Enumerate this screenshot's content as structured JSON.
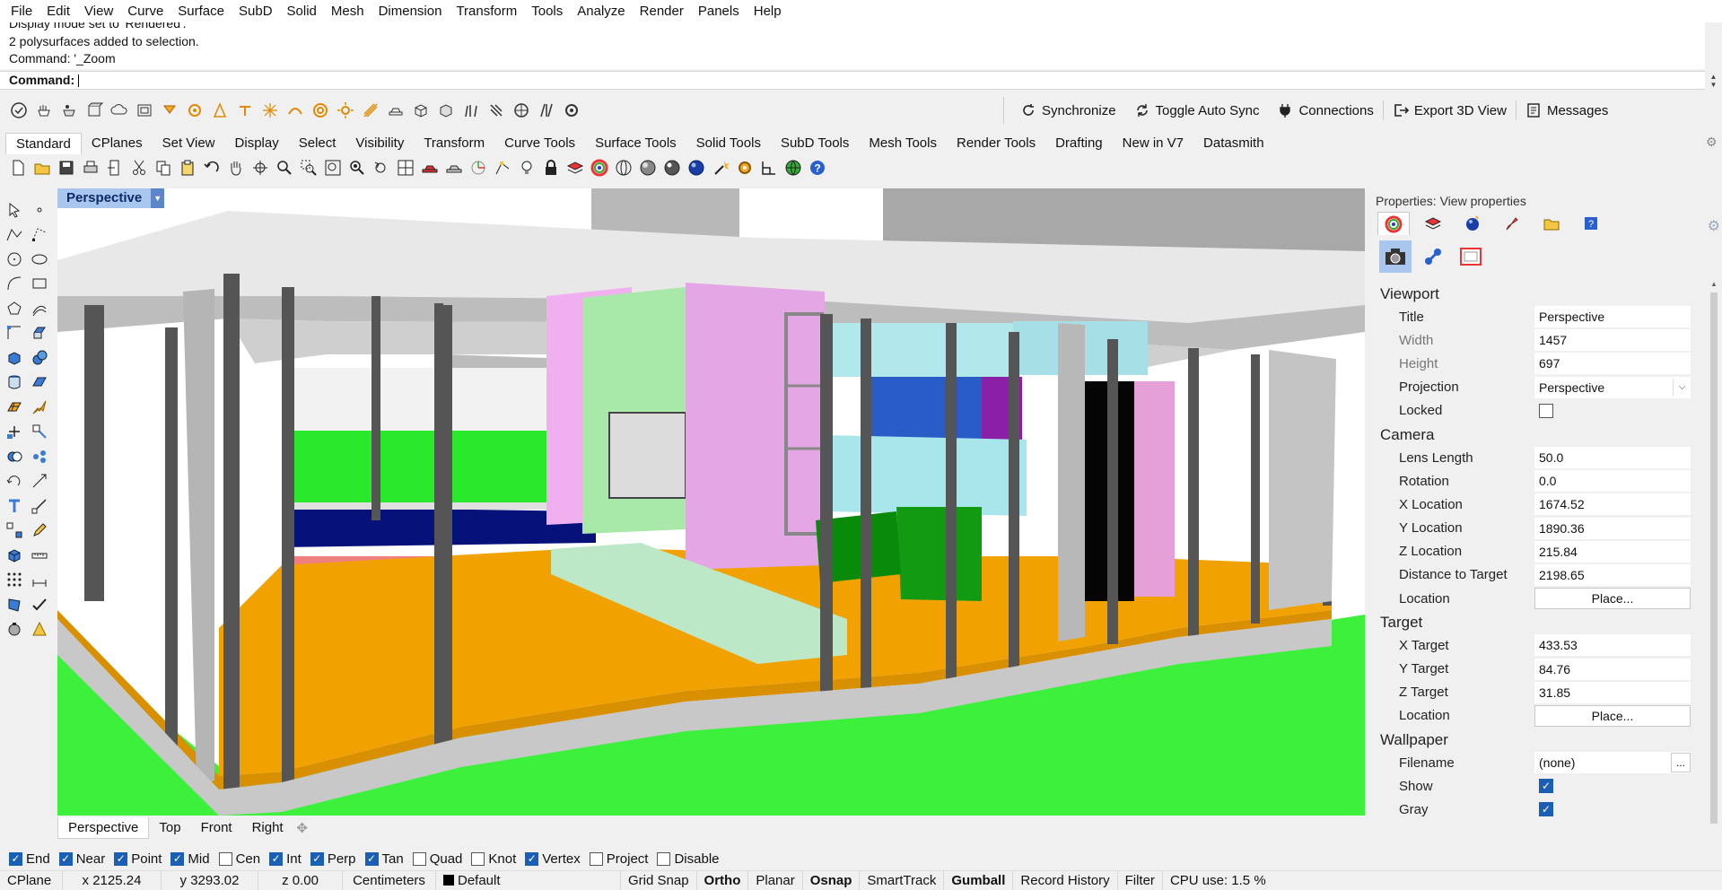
{
  "menu": [
    "File",
    "Edit",
    "View",
    "Curve",
    "Surface",
    "SubD",
    "Solid",
    "Mesh",
    "Dimension",
    "Transform",
    "Tools",
    "Analyze",
    "Render",
    "Panels",
    "Help"
  ],
  "command": {
    "history": [
      "Display mode set to 'Rendered'.",
      "2 polysurfaces added to selection.",
      "Command: '_Zoom"
    ],
    "prompt": "Command:"
  },
  "sync_tools": [
    {
      "label": "Synchronize",
      "icon": "sync-icon"
    },
    {
      "label": "Toggle Auto Sync",
      "icon": "auto-sync-icon"
    },
    {
      "label": "Connections",
      "icon": "plug-icon"
    },
    {
      "label": "Export 3D View",
      "icon": "export-icon"
    },
    {
      "label": "Messages",
      "icon": "messages-icon"
    }
  ],
  "tabs": [
    "Standard",
    "CPlanes",
    "Set View",
    "Display",
    "Select",
    "Visibility",
    "Transform",
    "Curve Tools",
    "Surface Tools",
    "Solid Tools",
    "SubD Tools",
    "Mesh Tools",
    "Render Tools",
    "Drafting",
    "New in V7",
    "Datasmith"
  ],
  "active_tab": "Standard",
  "viewport": {
    "label": "Perspective",
    "tabs": [
      "Perspective",
      "Top",
      "Front",
      "Right"
    ],
    "active_tab": "Perspective"
  },
  "properties": {
    "title": "Properties: View properties",
    "sections": {
      "viewport": {
        "heading": "Viewport",
        "title_label": "Title",
        "title_value": "Perspective",
        "width_label": "Width",
        "width_value": "1457",
        "height_label": "Height",
        "height_value": "697",
        "projection_label": "Projection",
        "projection_value": "Perspective",
        "locked_label": "Locked",
        "locked": false
      },
      "camera": {
        "heading": "Camera",
        "lens_label": "Lens Length",
        "lens_value": "50.0",
        "rotation_label": "Rotation",
        "rotation_value": "0.0",
        "xloc_label": "X Location",
        "xloc_value": "1674.52",
        "yloc_label": "Y Location",
        "yloc_value": "1890.36",
        "zloc_label": "Z Location",
        "zloc_value": "215.84",
        "dist_label": "Distance to Target",
        "dist_value": "2198.65",
        "location_label": "Location",
        "place_label": "Place..."
      },
      "target": {
        "heading": "Target",
        "x_label": "X Target",
        "x_value": "433.53",
        "y_label": "Y Target",
        "y_value": "84.76",
        "z_label": "Z Target",
        "z_value": "31.85",
        "location_label": "Location",
        "place_label": "Place..."
      },
      "wallpaper": {
        "heading": "Wallpaper",
        "filename_label": "Filename",
        "filename_value": "(none)",
        "more_label": "...",
        "show_label": "Show",
        "show": true,
        "gray_label": "Gray",
        "gray": true
      }
    }
  },
  "osnaps": [
    {
      "label": "End",
      "checked": true
    },
    {
      "label": "Near",
      "checked": true
    },
    {
      "label": "Point",
      "checked": true
    },
    {
      "label": "Mid",
      "checked": true
    },
    {
      "label": "Cen",
      "checked": false
    },
    {
      "label": "Int",
      "checked": true
    },
    {
      "label": "Perp",
      "checked": true
    },
    {
      "label": "Tan",
      "checked": true
    },
    {
      "label": "Quad",
      "checked": false
    },
    {
      "label": "Knot",
      "checked": false
    },
    {
      "label": "Vertex",
      "checked": true
    },
    {
      "label": "Project",
      "checked": false
    },
    {
      "label": "Disable",
      "checked": false
    }
  ],
  "status": {
    "cplane": "CPlane",
    "x": "x 2125.24",
    "y": "y 3293.02",
    "z": "z 0.00",
    "units": "Centimeters",
    "layer": "Default",
    "grid_snap": "Grid Snap",
    "ortho": "Ortho",
    "planar": "Planar",
    "osnap": "Osnap",
    "smarttrack": "SmartTrack",
    "gumball": "Gumball",
    "record_history": "Record History",
    "filter": "Filter",
    "cpu": "CPU use: 1.5 %"
  },
  "colors": {
    "accent": "#a9c6ee",
    "checkbox": "#1a5fb4",
    "grass": "#33ee33",
    "floor": "#f0a000"
  }
}
